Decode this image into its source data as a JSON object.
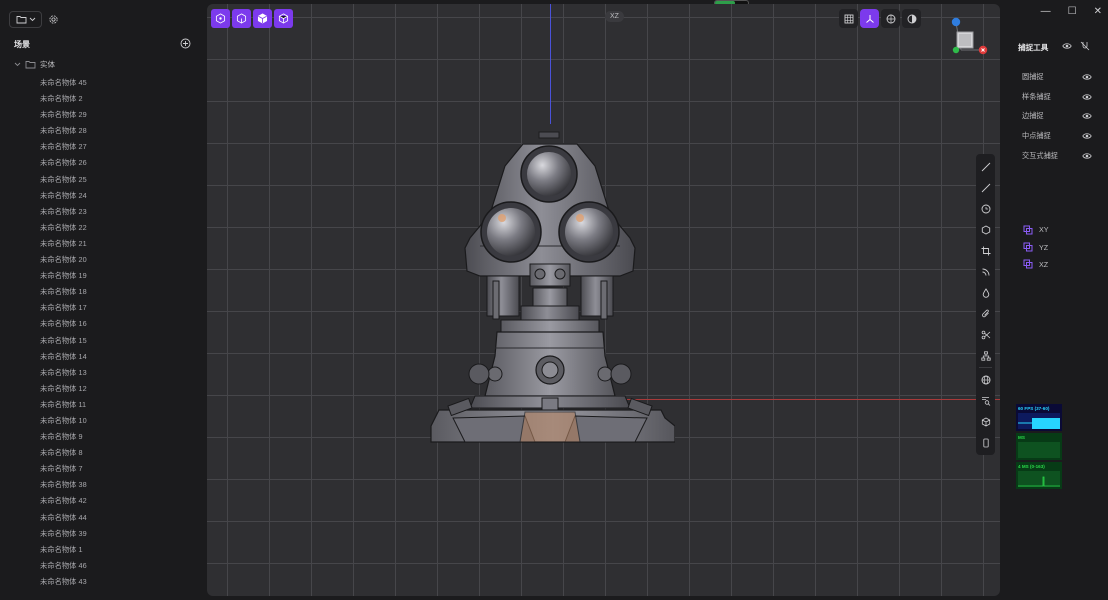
{
  "left_panel": {
    "scene_title": "场景",
    "entity_group": "实体",
    "objects": [
      "未命名物体 45",
      "未命名物体 2",
      "未命名物体 29",
      "未命名物体 28",
      "未命名物体 27",
      "未命名物体 26",
      "未命名物体 25",
      "未命名物体 24",
      "未命名物体 23",
      "未命名物体 22",
      "未命名物体 21",
      "未命名物体 20",
      "未命名物体 19",
      "未命名物体 18",
      "未命名物体 17",
      "未命名物体 16",
      "未命名物体 15",
      "未命名物体 14",
      "未命名物体 13",
      "未命名物体 12",
      "未命名物体 11",
      "未命名物体 10",
      "未命名物体 9",
      "未命名物体 8",
      "未命名物体 7",
      "未命名物体 38",
      "未命名物体 42",
      "未命名物体 44",
      "未命名物体 39",
      "未命名物体 1",
      "未命名物体 46",
      "未命名物体 43"
    ]
  },
  "viewport": {
    "view_label": "XZ",
    "accent_color": "#7c3aed",
    "grid_color": "#46464a",
    "background_color": "#2f2f32",
    "top_progress": 0.6
  },
  "right_panel": {
    "window_controls": [
      "—",
      "☐",
      "✕"
    ],
    "snap_title": "捕捉工具",
    "snap_items": [
      "圆捕捉",
      "样条捕捉",
      "边捕捉",
      "中点捕捉",
      "交互式捕捉"
    ],
    "planes": [
      "XY",
      "YZ",
      "XZ"
    ],
    "stats": {
      "fps": "60 FPS (37-60)",
      "ms": "MS",
      "mb": "4 MS (0-163)"
    }
  }
}
